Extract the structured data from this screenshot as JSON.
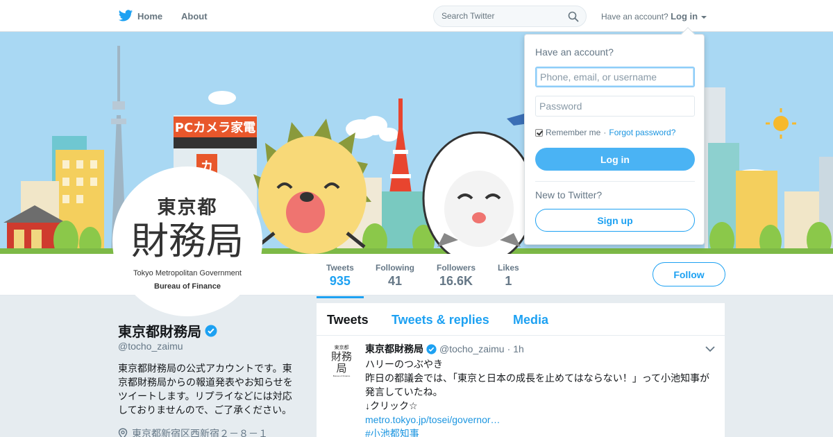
{
  "topbar": {
    "home_label": "Home",
    "about_label": "About",
    "search_placeholder": "Search Twitter",
    "account_prompt": "Have an account?",
    "login_label": "Log in"
  },
  "banner": {
    "shop_sign": "PCカメラ家電",
    "shop_sign_sub": "",
    "description_icon": "city-illustration"
  },
  "avatar": {
    "line1": "東京都",
    "line2": "財務局",
    "line3": "Tokyo Metropolitan Government",
    "line4": "Bureau of Finance"
  },
  "stats": [
    {
      "label": "Tweets",
      "value": "935"
    },
    {
      "label": "Following",
      "value": "41"
    },
    {
      "label": "Followers",
      "value": "16.6K"
    },
    {
      "label": "Likes",
      "value": "1"
    }
  ],
  "follow_label": "Follow",
  "profile": {
    "name": "東京都財務局",
    "handle": "@tocho_zaimu",
    "bio": "東京都財務局の公式アカウントです。東京都財務局からの報道発表やお知らせをツイートします。リプライなどには対応しておりませんので、ご了承ください。",
    "location": "東京都新宿区西新宿２－８－１"
  },
  "timeline": {
    "tabs": [
      "Tweets",
      "Tweets & replies",
      "Media"
    ],
    "tweet": {
      "name": "東京都財務局",
      "handle": "@tocho_zaimu",
      "sep": "·",
      "time": "1h",
      "line1": "ハリーのつぶやき",
      "line2": "昨日の都議会では、「東京と日本の成長を止めてはならない！」って小池知事が発言していたね。",
      "line3": "↓クリック☆",
      "link": "metro.tokyo.jp/tosei/governor…",
      "hashtag": "#小池都知事"
    }
  },
  "login_dropdown": {
    "title": "Have an account?",
    "username_placeholder": "Phone, email, or username",
    "password_placeholder": "Password",
    "remember_label": "Remember me",
    "separator": "·",
    "forgot_label": "Forgot password?",
    "login_button": "Log in",
    "new_prompt": "New to Twitter?",
    "signup_button": "Sign up"
  },
  "colors": {
    "accent": "#1da1f2",
    "login_button": "#4ab3f4",
    "link": "#1b95e0"
  }
}
